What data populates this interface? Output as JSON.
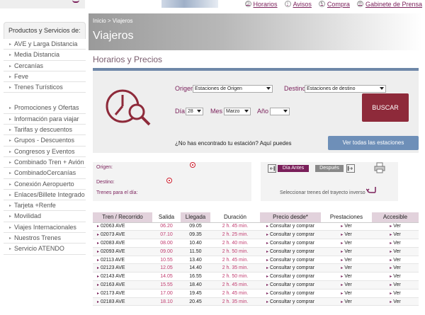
{
  "toplinks": [
    {
      "icon": "clock-icon",
      "label": "Horarios"
    },
    {
      "icon": "info-icon",
      "label": "Avisos"
    },
    {
      "icon": "cart-icon",
      "label": "Compra"
    },
    {
      "icon": "press-icon",
      "label": "Gabinete de Prensa"
    }
  ],
  "breadcrumb": "Inicio > Viajeros",
  "page_title": "Viajeros",
  "section_title": "Horarios y Precios",
  "sidebar": {
    "heading": "Productos y Servicios de:",
    "group1": [
      "AVE y Larga Distancia",
      "Media Distancia",
      "Cercanías",
      "Feve",
      "Trenes Turísticos"
    ],
    "group2": [
      "Promociones y Ofertas",
      "Información para viajar",
      "Tarifas y descuentos",
      "Grupos - Descuentos",
      "Congresos y Eventos",
      "Combinado Tren + Avión",
      "CombinadoCercanías",
      "Conexión Aeropuerto",
      "Enlaces/Billete Integrado",
      "Tarjeta +Renfe",
      "Movilidad",
      "Viajes Internacionales",
      "Nuestros Trenes",
      "Servicio ATENDO"
    ]
  },
  "search": {
    "origen_label": "Origen",
    "origen_value": "Estaciones de Origen",
    "destino_label": "Destino",
    "destino_value": "Estaciones de destino",
    "dia_label": "Día",
    "dia_value": "28",
    "mes_label": "Mes",
    "mes_value": "Marzo",
    "anio_label": "Año",
    "anio_value": "",
    "buscar_label": "BUSCAR",
    "hint": "¿No has encontrado tu estación? Aquí puedes",
    "ver_todas_label": "Ver todas las estaciones"
  },
  "info": {
    "origen_label": "Origen:",
    "destino_label": "Destino:",
    "trenes_label": "Trenes para el día:",
    "dia_antes_label": "Día Antes",
    "despues_label": "Después",
    "inverso_text": "Seleccionar trenes del trayecto inverso"
  },
  "table": {
    "headers": [
      "Tren / Recorrido",
      "Salida",
      "Llegada",
      "Duración",
      "Precio desde*",
      "Prestaciones",
      "Accesible"
    ],
    "rows": [
      [
        "02063 AVE",
        "06.20",
        "09.05",
        "2 h. 45 min.",
        "Consultar y comprar",
        "Ver",
        "Ver"
      ],
      [
        "02073 AVE",
        "07.10",
        "09.35",
        "2 h. 25 min.",
        "Consultar y comprar",
        "Ver",
        "Ver"
      ],
      [
        "02083 AVE",
        "08.00",
        "10.40",
        "2 h. 40 min.",
        "Consultar y comprar",
        "Ver",
        "Ver"
      ],
      [
        "02093 AVE",
        "09.00",
        "11.50",
        "2 h. 50 min.",
        "Consultar y comprar",
        "Ver",
        "Ver"
      ],
      [
        "02113 AVE",
        "10.55",
        "13.40",
        "2 h. 45 min.",
        "Consultar y comprar",
        "Ver",
        "Ver"
      ],
      [
        "02123 AVE",
        "12.05",
        "14.40",
        "2 h. 35 min.",
        "Consultar y comprar",
        "Ver",
        "Ver"
      ],
      [
        "02143 AVE",
        "14.05",
        "16.55",
        "2 h. 50 min.",
        "Consultar y comprar",
        "Ver",
        "Ver"
      ],
      [
        "02163 AVE",
        "15.55",
        "18.40",
        "2 h. 45 min.",
        "Consultar y comprar",
        "Ver",
        "Ver"
      ],
      [
        "02173 AVE",
        "17.00",
        "19.45",
        "2 h. 45 min.",
        "Consultar y comprar",
        "Ver",
        "Ver"
      ],
      [
        "02183 AVE",
        "18.10",
        "20.45",
        "2 h. 35 min.",
        "Consultar y comprar",
        "Ver",
        "Ver"
      ]
    ]
  },
  "colors": {
    "brand": "#7a1f5a",
    "panel_border": "#6e87a8",
    "buscar_bg": "#8e2a3a",
    "time_text": "#c03a6e"
  }
}
